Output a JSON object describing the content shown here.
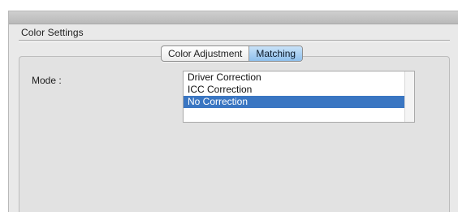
{
  "panel": {
    "section_title": "Color Settings"
  },
  "tabs": [
    {
      "label": "Color Adjustment",
      "active": false
    },
    {
      "label": "Matching",
      "active": true
    }
  ],
  "mode": {
    "label": "Mode :",
    "options": [
      "Driver Correction",
      "ICC Correction",
      "No Correction"
    ],
    "selected": "No Correction"
  },
  "colors": {
    "selection": "#3a76c2",
    "active_tab": "#9ccaf0"
  }
}
